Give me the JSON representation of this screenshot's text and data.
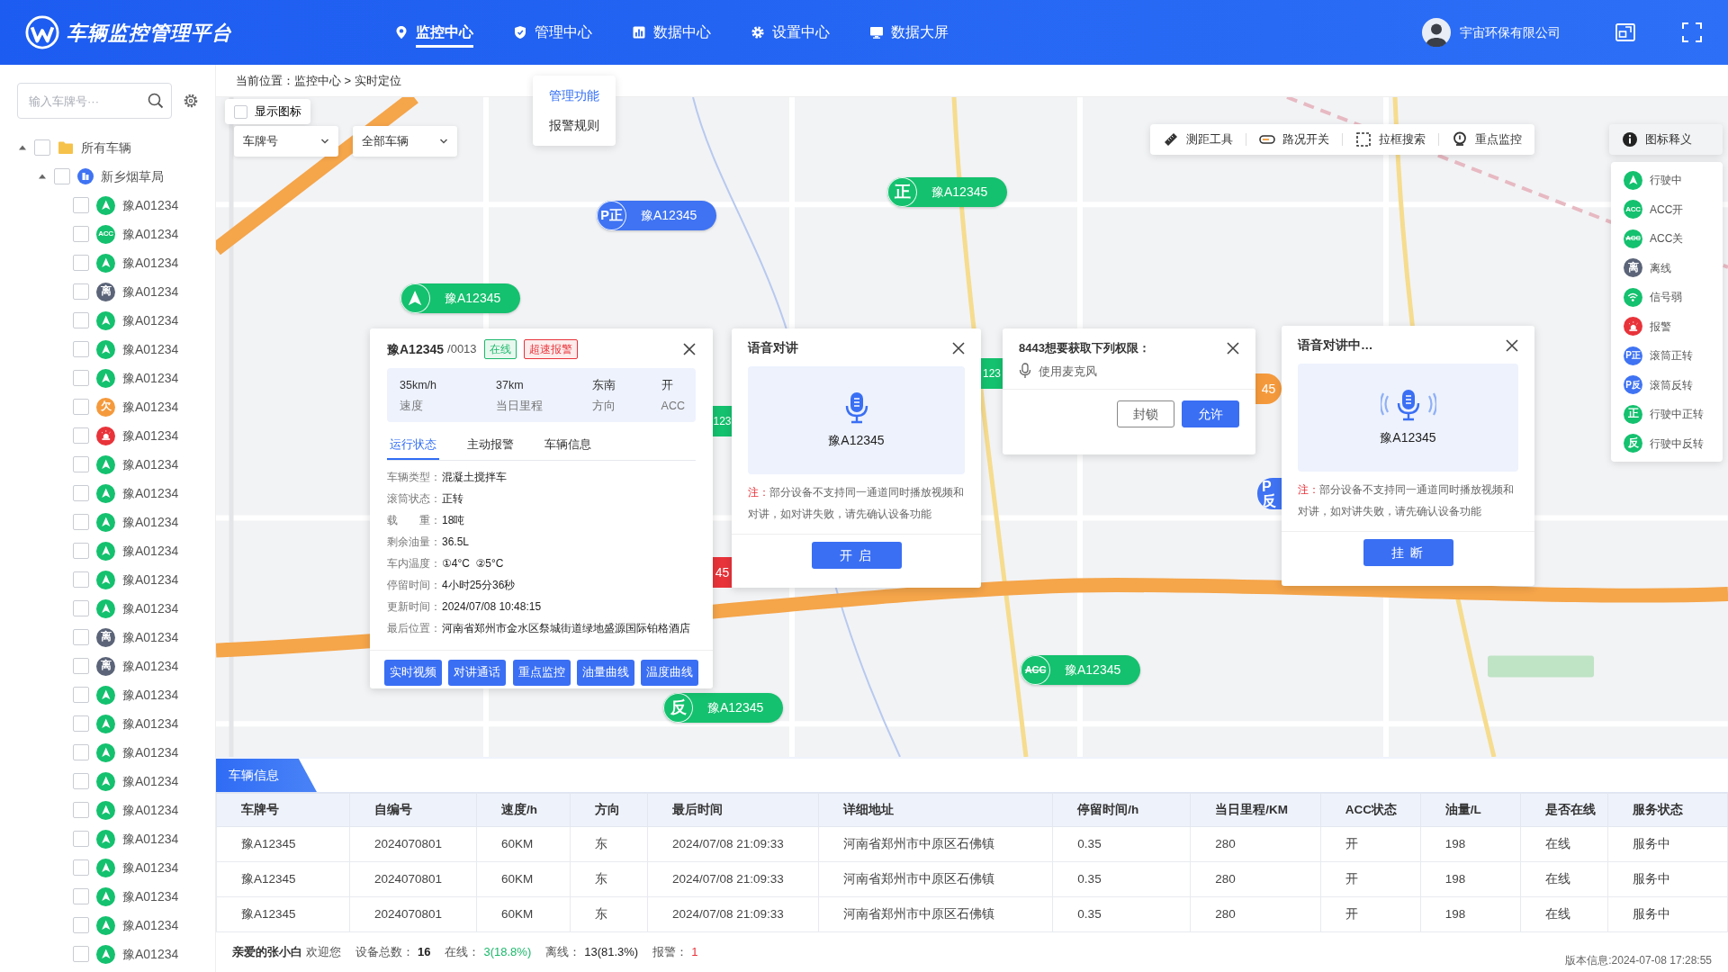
{
  "header": {
    "title": "车辆监控管理平台",
    "nav": [
      {
        "label": "监控中心",
        "selected": true
      },
      {
        "label": "管理中心",
        "selected": false
      },
      {
        "label": "数据中心",
        "selected": false
      },
      {
        "label": "设置中心",
        "selected": false
      },
      {
        "label": "数据大屏",
        "selected": false
      }
    ],
    "company": "宇宙环保有限公司"
  },
  "dropdown": [
    {
      "label": "管理功能",
      "selected": true
    },
    {
      "label": "报警规则",
      "selected": false
    }
  ],
  "sidebar": {
    "search_placeholder": "输入车牌号···",
    "tree": [
      {
        "label": "所有车辆",
        "checked": false,
        "expanded": true,
        "children": [
          {
            "label": "新乡烟草局",
            "checked": false,
            "expanded": true,
            "children": [
              {
                "label": "豫A01234",
                "checked": false,
                "kind": "driving"
              },
              {
                "label": "豫A01234",
                "checked": false,
                "kind": "acc_on",
                "icon_text": "ACC"
              },
              {
                "label": "豫A01234",
                "checked": false,
                "kind": "driving"
              },
              {
                "label": "豫A01234",
                "checked": false,
                "kind": "offline",
                "icon_text": "离"
              },
              {
                "label": "豫A01234",
                "checked": false,
                "kind": "driving"
              },
              {
                "label": "豫A01234",
                "checked": false,
                "kind": "driving"
              },
              {
                "label": "豫A01234",
                "checked": false,
                "kind": "driving"
              },
              {
                "label": "豫A01234",
                "checked": false,
                "kind": "overdue",
                "icon_text": "欠"
              },
              {
                "label": "豫A01234",
                "checked": false,
                "kind": "alarm"
              },
              {
                "label": "豫A01234",
                "checked": false,
                "kind": "driving"
              },
              {
                "label": "豫A01234",
                "checked": false,
                "kind": "driving"
              },
              {
                "label": "豫A01234",
                "checked": false,
                "kind": "driving"
              },
              {
                "label": "豫A01234",
                "checked": false,
                "kind": "driving"
              },
              {
                "label": "豫A01234",
                "checked": false,
                "kind": "driving"
              },
              {
                "label": "豫A01234",
                "checked": false,
                "kind": "driving"
              },
              {
                "label": "豫A01234",
                "checked": false,
                "kind": "offline",
                "icon_text": "离"
              },
              {
                "label": "豫A01234",
                "checked": false,
                "kind": "offline",
                "icon_text": "离"
              },
              {
                "label": "豫A01234",
                "checked": false,
                "kind": "driving"
              },
              {
                "label": "豫A01234",
                "checked": false,
                "kind": "driving"
              },
              {
                "label": "豫A01234",
                "checked": false,
                "kind": "driving"
              },
              {
                "label": "豫A01234",
                "checked": false,
                "kind": "driving"
              },
              {
                "label": "豫A01234",
                "checked": false,
                "kind": "driving"
              },
              {
                "label": "豫A01234",
                "checked": false,
                "kind": "driving"
              },
              {
                "label": "豫A01234",
                "checked": false,
                "kind": "driving"
              },
              {
                "label": "豫A01234",
                "checked": false,
                "kind": "driving"
              },
              {
                "label": "豫A01234",
                "checked": false,
                "kind": "driving"
              },
              {
                "label": "豫A01234",
                "checked": false,
                "kind": "driving"
              }
            ]
          }
        ]
      }
    ]
  },
  "breadcrumb": "当前位置：监控中心 > 实时定位",
  "map": {
    "kind": "picture",
    "show_icons": {
      "label": "显示图标",
      "checked": false
    },
    "selects": [
      "车牌号",
      "全部车辆"
    ],
    "tools": [
      "测距工具",
      "路况开关",
      "拉框搜索",
      "重点监控"
    ],
    "legend_button": "图标释义",
    "legend": [
      {
        "label": "行驶中",
        "kind": "driving"
      },
      {
        "label": "ACC开",
        "kind": "acc_on",
        "icon_text": "ACC"
      },
      {
        "label": "ACC关",
        "kind": "acc_off",
        "icon_text": "ACC"
      },
      {
        "label": "离线",
        "kind": "offline",
        "icon_text": "离"
      },
      {
        "label": "信号弱",
        "kind": "weak_signal"
      },
      {
        "label": "报警",
        "kind": "alarm"
      },
      {
        "label": "滚筒正转",
        "kind": "drum_forward",
        "icon_text": "P正"
      },
      {
        "label": "滚筒反转",
        "kind": "drum_reverse",
        "icon_text": "P反"
      },
      {
        "label": "行驶中正转",
        "kind": "driving_forward",
        "icon_text": "正"
      },
      {
        "label": "行驶中反转",
        "kind": "driving_reverse",
        "icon_text": "反"
      }
    ],
    "markers": [
      {
        "kind": "drum_forward",
        "icon_text": "P正",
        "plate": "豫A12345"
      },
      {
        "kind": "driving_forward",
        "icon_text": "正",
        "plate": "豫A12345"
      },
      {
        "kind": "driving",
        "plate": "豫A12345"
      },
      {
        "kind": "driving_reverse",
        "icon_text": "反",
        "plate": "豫A12345"
      },
      {
        "kind": "acc_off",
        "icon_text": "ACC",
        "plate": "豫A12345"
      },
      {
        "kind": "drum_reverse",
        "icon_text": "P反"
      }
    ],
    "marker_fragments": [
      {
        "text": "123",
        "color": "#14c16e"
      },
      {
        "text": "45",
        "color": "#e8333a"
      },
      {
        "text": "123",
        "color": "#14c16e"
      },
      {
        "text": "45",
        "color": "#f59a3c"
      }
    ]
  },
  "vehicle_popup": {
    "plate": "豫A12345",
    "code": "/0013",
    "tags": [
      {
        "text": "在线",
        "kind": "success"
      },
      {
        "text": "超速报警",
        "kind": "danger"
      }
    ],
    "stats": [
      {
        "value": "35km/h",
        "label": "速度"
      },
      {
        "value": "37km",
        "label": "当日里程"
      },
      {
        "value": "东南",
        "label": "方向"
      },
      {
        "value": "开",
        "label": "ACC"
      }
    ],
    "tabs": [
      {
        "label": "运行状态",
        "selected": true
      },
      {
        "label": "主动报警",
        "selected": false
      },
      {
        "label": "车辆信息",
        "selected": false
      }
    ],
    "fields": [
      {
        "label": "车辆类型：",
        "value": "混凝土搅拌车"
      },
      {
        "label": "滚筒状态：",
        "value": "正转"
      },
      {
        "label": "载　　重：",
        "value": "18吨"
      },
      {
        "label": "剩余油量：",
        "value": "36.5L"
      },
      {
        "label": "车内温度：",
        "value": "①4°C  ②5°C"
      },
      {
        "label": "停留时间：",
        "value": "4小时25分36秒"
      },
      {
        "label": "更新时间：",
        "value": "2024/07/08 10:48:15"
      },
      {
        "label": "最后位置：",
        "value": "河南省郑州市金水区祭城街道绿地盛源国际铂格酒店"
      }
    ],
    "buttons": [
      "实时视频",
      "对讲通话",
      "重点监控",
      "油量曲线",
      "温度曲线"
    ]
  },
  "intercoms": [
    {
      "title": "语音对讲",
      "plate": "豫A12345",
      "note_label": "注：",
      "note": "部分设备不支持同一通道同时播放视频和对讲，如对讲失败，请先确认设备功能",
      "button": "开 启",
      "active": false
    },
    {
      "title": "语音对讲中…",
      "plate": "豫A12345",
      "note_label": "注：",
      "note": "部分设备不支持同一通道同时播放视频和对讲，如对讲失败，请先确认设备功能",
      "button": "挂 断",
      "active": true
    }
  ],
  "permission": {
    "title": "8443想要获取下列权限：",
    "item": "使用麦克风",
    "buttons": [
      {
        "label": "封锁",
        "kind": "outline"
      },
      {
        "label": "允许",
        "kind": "primary"
      }
    ]
  },
  "bottom": {
    "tab": "车辆信息",
    "table": {
      "columns": [
        "车牌号",
        "自编号",
        "速度/h",
        "方向",
        "最后时间",
        "详细地址",
        "停留时间/h",
        "当日里程/KM",
        "ACC状态",
        "油量/L",
        "是否在线",
        "服务状态"
      ],
      "rows": [
        [
          "豫A12345",
          "2024070801",
          "60KM",
          "东",
          "2024/07/08 21:09:33",
          "河南省郑州市中原区石佛镇",
          "0.35",
          "280",
          "开",
          "198",
          "在线",
          "服务中"
        ],
        [
          "豫A12345",
          "2024070801",
          "60KM",
          "东",
          "2024/07/08 21:09:33",
          "河南省郑州市中原区石佛镇",
          "0.35",
          "280",
          "开",
          "198",
          "在线",
          "服务中"
        ],
        [
          "豫A12345",
          "2024070801",
          "60KM",
          "东",
          "2024/07/08 21:09:33",
          "河南省郑州市中原区石佛镇",
          "0.35",
          "280",
          "开",
          "198",
          "在线",
          "服务中"
        ]
      ]
    },
    "status_bar": {
      "user": "亲爱的张小白",
      "greeting": "欢迎您",
      "stats": [
        {
          "label": "设备总数：",
          "value": "16",
          "kind": "total"
        },
        {
          "label": "在线：",
          "value": "3(18.8%)",
          "kind": "online"
        },
        {
          "label": "离线：",
          "value": "13(81.3%)",
          "kind": "offline"
        },
        {
          "label": "报警：",
          "value": "1",
          "kind": "alarm"
        }
      ],
      "version": "版本信息:2024-07-08 17:28:55"
    }
  }
}
